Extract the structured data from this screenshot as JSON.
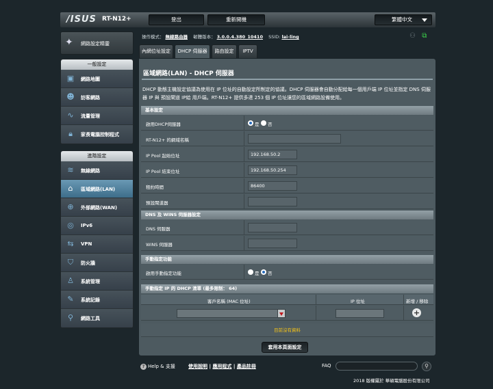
{
  "header": {
    "logo": "/ISUS",
    "model": "RT-N12+",
    "logout": "登出",
    "reboot": "重新開機",
    "language": "繁體中文"
  },
  "status": {
    "mode_label": "操作模式：",
    "mode_value": "無線路由器",
    "fw_label": "韌體版本：",
    "fw_value": "3.0.0.4.380_10410",
    "ssid_label": "SSID:",
    "ssid_value": "lai-ling"
  },
  "sidebar": {
    "qis": "網路設定精靈",
    "general_title": "一般設定",
    "general": [
      {
        "label": "網路地圖",
        "icon": "network-map-icon"
      },
      {
        "label": "訪客網路",
        "icon": "guest-network-icon"
      },
      {
        "label": "流量管理",
        "icon": "traffic-manager-icon"
      },
      {
        "label": "家長電腦控制程式",
        "icon": "parental-control-icon"
      }
    ],
    "advanced_title": "進階設定",
    "advanced": [
      {
        "label": "無線網路",
        "icon": "wireless-icon"
      },
      {
        "label": "區域網路(LAN)",
        "icon": "lan-icon"
      },
      {
        "label": "外部網路(WAN)",
        "icon": "wan-icon"
      },
      {
        "label": "IPv6",
        "icon": "ipv6-icon"
      },
      {
        "label": "VPN",
        "icon": "vpn-icon"
      },
      {
        "label": "防火牆",
        "icon": "firewall-icon"
      },
      {
        "label": "系統管理",
        "icon": "administration-icon"
      },
      {
        "label": "系統記錄",
        "icon": "system-log-icon"
      },
      {
        "label": "網路工具",
        "icon": "network-tools-icon"
      }
    ]
  },
  "tabs": [
    "內網位址設定",
    "DHCP 伺服器",
    "路由設定",
    "IPTV"
  ],
  "page": {
    "title": "區域網路(LAN) - DHCP 伺服器",
    "description": "DHCP 動態主機設定協議為使用在 IP 位址的自動設定所制定的協議。DHCP 伺服器會自動分配給每一個用戶端 IP 位址並指定 DNS 伺服器 IP 與 預設閘道 IP給 用戶端。RT-N12+ 提供多達 253 個 IP 位址讓您的區域網路設備使用。"
  },
  "basic": {
    "title": "基本設定",
    "enable_label": "啟用DHCP伺服器",
    "yes": "是",
    "no": "否",
    "domain_label": "RT-N12+ 的網域名稱",
    "domain_value": "",
    "start_label": "IP Pool 起始位址",
    "start_value": "192.168.50.2",
    "end_label": "IP Pool 結束位址",
    "end_value": "192.168.50.254",
    "lease_label": "租約時間",
    "lease_value": "86400",
    "gateway_label": "預設閘道器",
    "gateway_value": ""
  },
  "dns": {
    "title": "DNS 及 WINS 伺服器設定",
    "dns_label": "DNS 伺服器",
    "dns_value": "",
    "wins_label": "WINS 伺服器",
    "wins_value": ""
  },
  "manual": {
    "title": "手動指定功能",
    "enable_label": "啟用手動指定功能",
    "yes": "是",
    "no": "否"
  },
  "list": {
    "title": "手動指定 IP 的 DHCP 清單 (最多限制： 64)",
    "col_client": "客戶名稱 (MAC 位址)",
    "col_ip": "IP 位址",
    "col_action": "新增 / 移除",
    "no_data": "目前沒有資料"
  },
  "apply": "套用本頁面設定",
  "footer": {
    "help": "Help & 支援",
    "link1": "使用說明",
    "link2": "應用程式",
    "link3": "產品註冊",
    "divider": "|",
    "faq": "FAQ",
    "copyright": "2018 版權屬於 華碩電腦股份有限公司"
  }
}
